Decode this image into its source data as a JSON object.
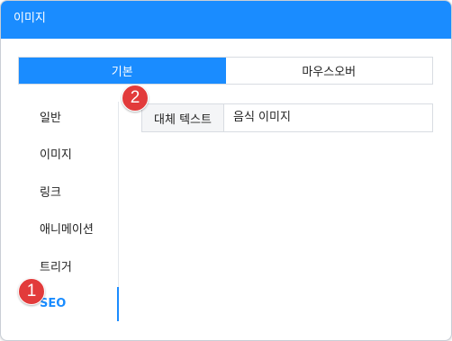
{
  "dialog": {
    "title": "이미지"
  },
  "tabs": [
    {
      "label": "기본",
      "active": true
    },
    {
      "label": "마우스오버",
      "active": false
    }
  ],
  "sidebar": {
    "items": [
      {
        "label": "일반",
        "active": false
      },
      {
        "label": "이미지",
        "active": false
      },
      {
        "label": "링크",
        "active": false
      },
      {
        "label": "애니메이션",
        "active": false
      },
      {
        "label": "트리거",
        "active": false
      },
      {
        "label": "SEO",
        "active": true
      }
    ]
  },
  "seo": {
    "alt_text_label": "대체 텍스트",
    "alt_text_value": "음식 이미지"
  },
  "markers": [
    "1",
    "2"
  ],
  "colors": {
    "accent": "#1a8cff",
    "marker": "#e23b3b"
  }
}
